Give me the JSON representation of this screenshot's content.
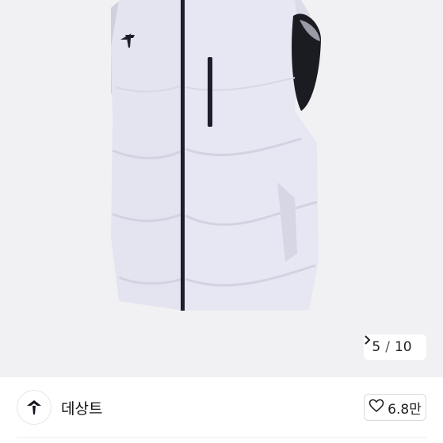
{
  "gallery": {
    "current": "5",
    "separator": "/",
    "total": "10",
    "next_icon": "chevron-right-icon"
  },
  "brand": {
    "name": "데상트",
    "logo_icon": "descente-logo-icon"
  },
  "like": {
    "count": "6.8만",
    "icon": "heart-outline-icon"
  },
  "colors": {
    "image_background": "#f1f1f3",
    "vest": "#e3e3f0",
    "zipper": "#1c1f2b"
  }
}
